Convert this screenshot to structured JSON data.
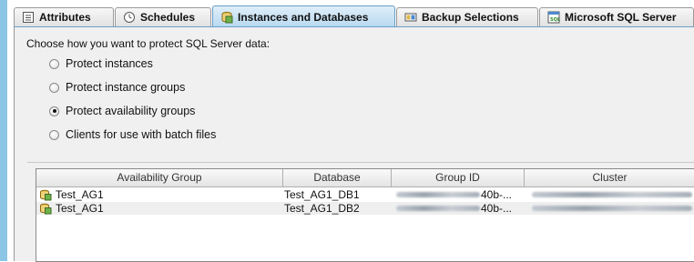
{
  "tabs": [
    {
      "label": "Attributes",
      "icon": "attributes-icon",
      "active": false
    },
    {
      "label": "Schedules",
      "icon": "schedules-icon",
      "active": false
    },
    {
      "label": "Instances and Databases",
      "icon": "instances-databases-icon",
      "active": true
    },
    {
      "label": "Backup Selections",
      "icon": "backup-selections-icon",
      "active": false
    },
    {
      "label": "Microsoft SQL Server",
      "icon": "sql-server-icon",
      "active": false
    }
  ],
  "panel": {
    "prompt": "Choose how you want to protect SQL Server data:",
    "options": [
      {
        "label": "Protect instances",
        "selected": false
      },
      {
        "label": "Protect instance groups",
        "selected": false
      },
      {
        "label": "Protect availability groups",
        "selected": true
      },
      {
        "label": "Clients for use with batch files",
        "selected": false
      }
    ]
  },
  "table": {
    "columns": [
      "Availability Group",
      "Database",
      "Group ID",
      "Cluster"
    ],
    "rows": [
      {
        "availability_group": "Test_AG1",
        "database": "Test_AG1_DB1",
        "group_id_visible": "40b-..."
      },
      {
        "availability_group": "Test_AG1",
        "database": "Test_AG1_DB2",
        "group_id_visible": "40b-..."
      }
    ]
  },
  "colors": {
    "accent": "#8cc6e6",
    "active_tab": "#c6e1f4",
    "panel_bg": "#f0f0f0"
  }
}
